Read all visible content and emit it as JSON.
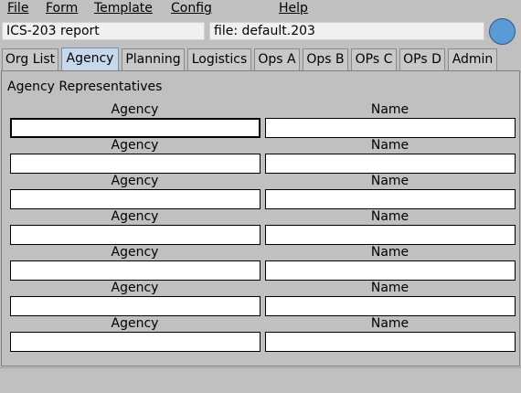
{
  "menu": {
    "file": "File",
    "form": "Form",
    "template": "Template",
    "config": "Config",
    "help": "Help"
  },
  "header": {
    "report_title": "ICS-203 report",
    "file_label": "file: default.203",
    "status_color": "#5b9bd5"
  },
  "tabs": [
    {
      "label": "Org List"
    },
    {
      "label": "Agency"
    },
    {
      "label": "Planning"
    },
    {
      "label": "Logistics"
    },
    {
      "label": "Ops A"
    },
    {
      "label": "Ops B"
    },
    {
      "label": "OPs C"
    },
    {
      "label": "OPs D"
    },
    {
      "label": "Admin"
    }
  ],
  "agency_panel": {
    "title": "Agency Representatives",
    "agency_label": "Agency",
    "name_label": "Name",
    "rows": [
      {
        "agency": "",
        "name": ""
      },
      {
        "agency": "",
        "name": ""
      },
      {
        "agency": "",
        "name": ""
      },
      {
        "agency": "",
        "name": ""
      },
      {
        "agency": "",
        "name": ""
      },
      {
        "agency": "",
        "name": ""
      },
      {
        "agency": "",
        "name": ""
      }
    ]
  }
}
